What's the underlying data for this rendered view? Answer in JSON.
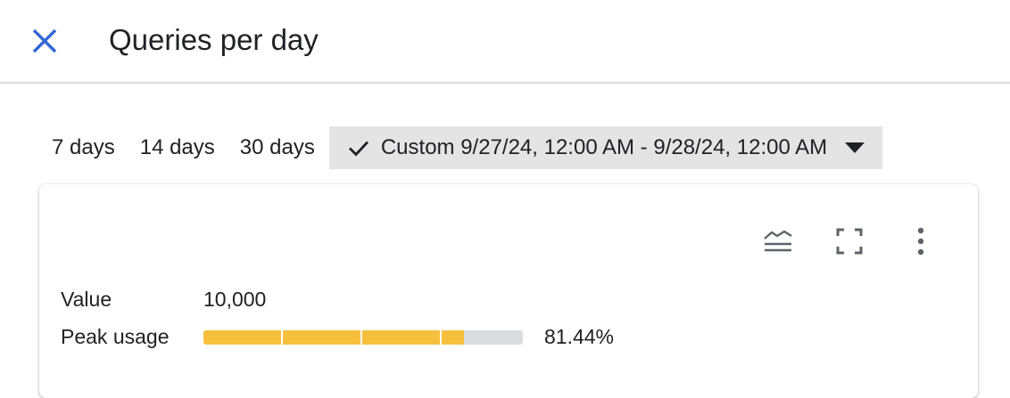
{
  "header": {
    "title": "Queries per day",
    "close_icon": "close-icon",
    "accent_color": "#3367d6"
  },
  "range": {
    "options": [
      "7 days",
      "14 days",
      "30 days"
    ],
    "custom_label": "Custom 9/27/24, 12:00 AM - 9/28/24, 12:00 AM",
    "custom_selected": true,
    "check_icon": "check-icon",
    "dropdown_icon": "arrow-drop-down-icon"
  },
  "card": {
    "toolbar_icons": [
      "chart-legend-icon",
      "fullscreen-icon",
      "more-vert-icon"
    ],
    "value_label": "Value",
    "value": "10,000",
    "peak_label": "Peak usage",
    "peak_percent_text": "81.44%",
    "peak_fraction": 0.8144,
    "bar_color": "#f6bf3e",
    "track_color": "#dadce0"
  }
}
